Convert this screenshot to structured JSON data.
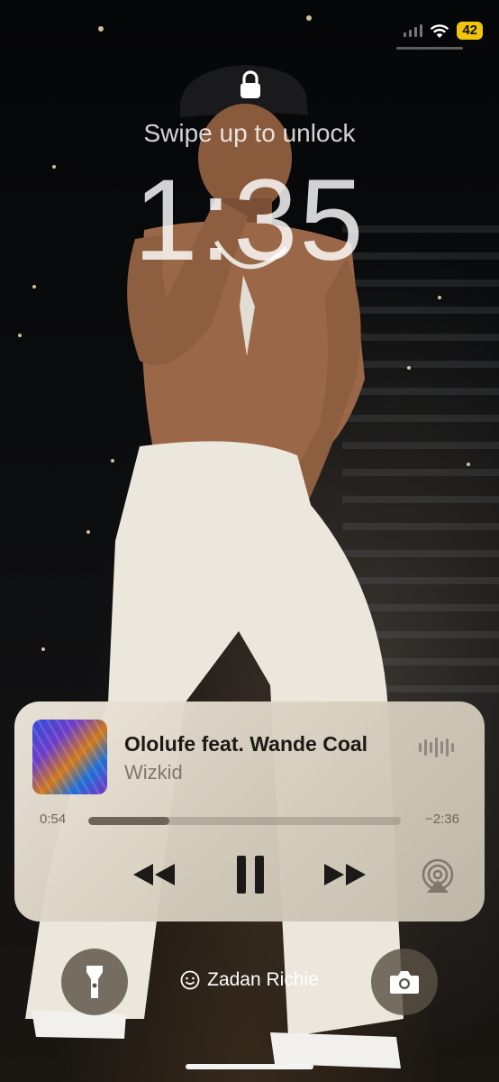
{
  "status_bar": {
    "battery_level": "42",
    "battery_color": "#f1c40f"
  },
  "lock_screen": {
    "hint": "Swipe up to unlock",
    "time": "1:35",
    "owner_name": "Zadan Richie"
  },
  "now_playing": {
    "title": "Ololufe feat. Wande Coal",
    "artist": "Wizkid",
    "elapsed": "0:54",
    "remaining": "−2:36",
    "progress_fraction": 0.26,
    "state": "playing"
  },
  "icons": {
    "lock": "lock-icon",
    "wifi": "wifi-icon",
    "flashlight": "flashlight-icon",
    "camera": "camera-icon",
    "rewind": "rewind-icon",
    "pause": "pause-icon",
    "forward": "fast-forward-icon",
    "airplay": "airplay-icon",
    "waveform": "waveform-icon",
    "smile": "smile-icon"
  }
}
